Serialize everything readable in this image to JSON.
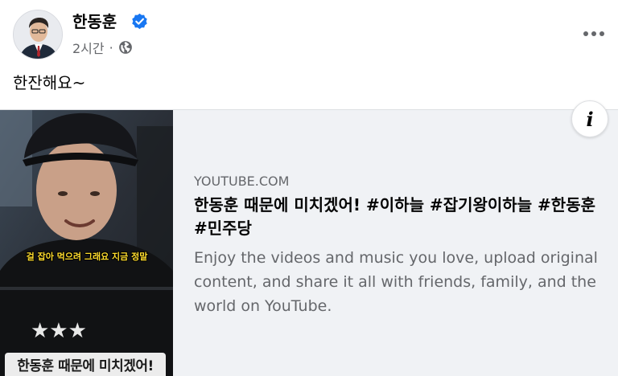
{
  "post": {
    "author_name": "한동훈",
    "verified": true,
    "timestamp": "2시간",
    "separator": "·",
    "audience_icon": "globe-icon",
    "text": "한잔해요~",
    "more_icon": "more-horizontal-icon"
  },
  "link_card": {
    "domain": "YOUTUBE.COM",
    "title": "한동훈 때문에 미치겠어! #이하늘 #잡기왕이하늘 #한동훈 #민주당",
    "description": "Enjoy the videos and music you love, upload original content, and share it all with friends, family, and the world on YouTube.",
    "info_icon": "info-icon",
    "thumbnail": {
      "subtitle": "걸 잡아 먹으려 그래요 지금 정말",
      "caption": "한동훈 때문에 미치겠어!"
    }
  },
  "colors": {
    "verified_blue": "#1877f2",
    "secondary_text": "#65676b",
    "card_background": "#f0f2f5"
  }
}
